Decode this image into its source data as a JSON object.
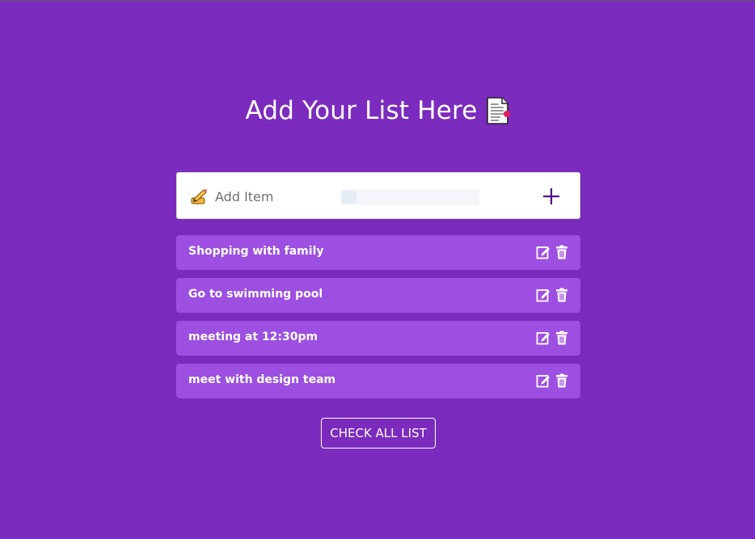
{
  "header": {
    "title": "Add Your List Here",
    "title_icon": "document-icon"
  },
  "input": {
    "placeholder": "Add Item",
    "value": "",
    "leading_icon": "writing-hand-icon",
    "add_button_icon": "plus-icon"
  },
  "todos": [
    {
      "text": "Shopping with family"
    },
    {
      "text": "Go to swimming pool"
    },
    {
      "text": "meeting at 12:30pm"
    },
    {
      "text": "meet with design team"
    }
  ],
  "item_actions": {
    "edit_icon": "edit-icon",
    "delete_icon": "trash-icon"
  },
  "footer": {
    "check_all_label": "CHECK ALL LIST"
  },
  "colors": {
    "background": "#7b2bbd",
    "item_background": "#9c4fe0",
    "accent": "#4b0f8c"
  }
}
